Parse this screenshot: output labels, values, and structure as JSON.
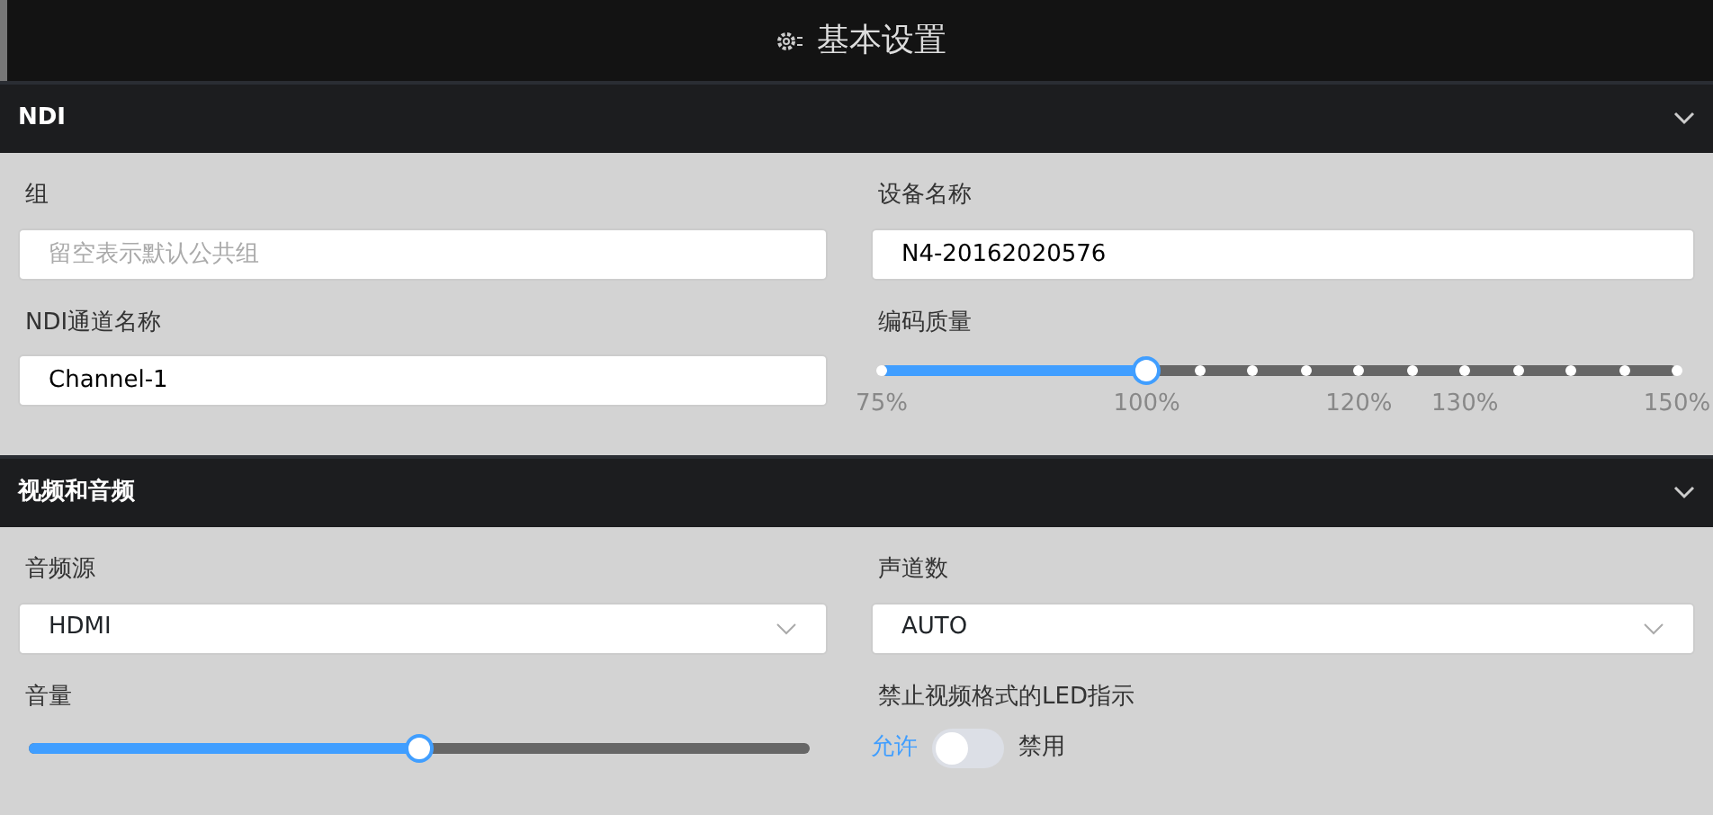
{
  "window": {
    "title": "基本设置"
  },
  "sections": [
    {
      "title": "NDI",
      "expanded": true,
      "fields": [
        {
          "kind": "input",
          "label": "组",
          "placeholder": "留空表示默认公共组"
        },
        {
          "kind": "input",
          "label": "设备名称",
          "value": "N4-20162020576"
        },
        {
          "kind": "input",
          "label": "NDI通道名称",
          "value": "Channel-1"
        },
        {
          "kind": "ticks",
          "label": "编码质量",
          "level": 0.3333,
          "ticks": [
            "75%",
            "100%",
            "120%",
            "130%",
            "150%"
          ]
        }
      ]
    },
    {
      "title": "视频和音频",
      "expanded": true,
      "fields": [
        {
          "kind": "select",
          "label": "音频源",
          "value": "HDMI"
        },
        {
          "kind": "select",
          "label": "声道数",
          "value": "AUTO"
        },
        {
          "kind": "slider",
          "label": "音量",
          "level": 0.5
        },
        {
          "kind": "toggle",
          "label": "禁止视频格式的LED指示",
          "on": false,
          "off_label": "允许",
          "on_label": "禁用"
        }
      ]
    }
  ]
}
